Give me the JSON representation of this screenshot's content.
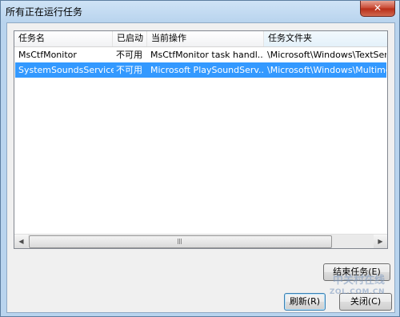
{
  "window": {
    "title": "所有正在运行任务",
    "close_glyph": "✕"
  },
  "list": {
    "columns": [
      "任务名",
      "已启动",
      "当前操作",
      "任务文件夹"
    ],
    "rows": [
      {
        "name": "MsCtfMonitor",
        "started": "不可用",
        "action": "MsCtfMonitor task handl...",
        "folder": "\\Microsoft\\Windows\\TextServic"
      },
      {
        "name": "SystemSoundsService",
        "started": "不可用",
        "action": "Microsoft PlaySoundServ...",
        "folder": "\\Microsoft\\Windows\\Multimed"
      }
    ],
    "selected_row": 1
  },
  "scrollbar": {
    "left_arrow": "◀",
    "right_arrow": "▶"
  },
  "buttons": {
    "end_task": "结束任务(E)",
    "refresh": "刷新(R)",
    "close": "关闭(C)"
  },
  "watermark": {
    "line1": "中关村在线",
    "line2": "ZOL.COM.CN"
  },
  "colors": {
    "selection": "#3399ff",
    "window_frame": "#b9d4ee",
    "close_button": "#c8452f"
  }
}
